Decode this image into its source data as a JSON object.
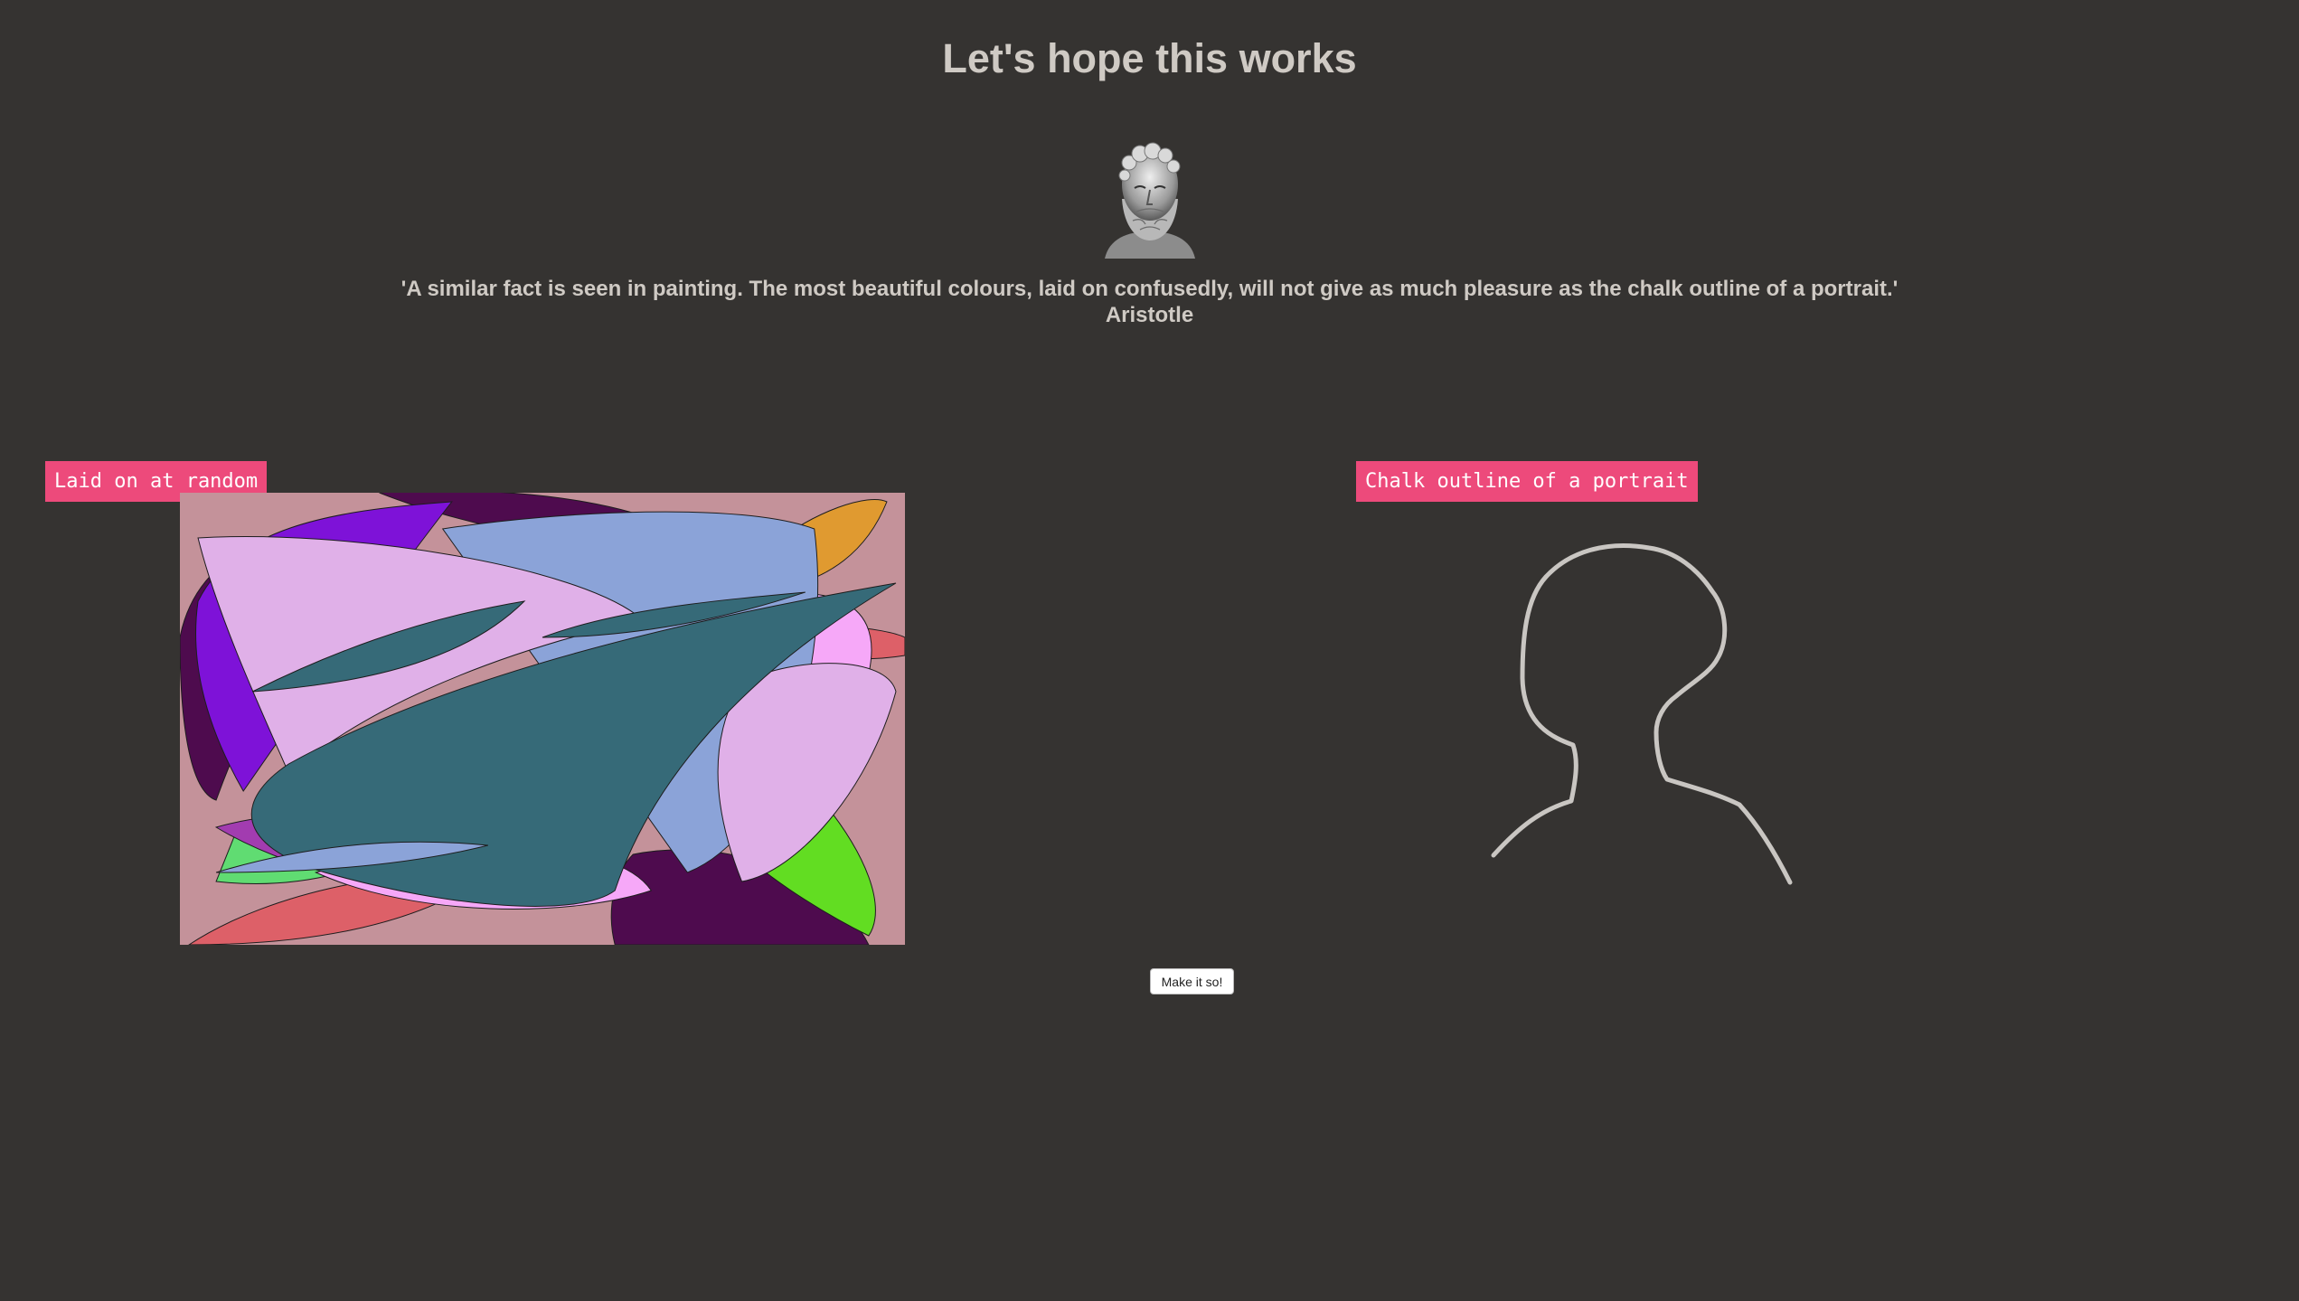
{
  "page": {
    "title": "Let's hope this works"
  },
  "quote": {
    "text": "'A similar fact is seen in painting. The most beautiful colours, laid on confusedly, will not give as much pleasure as the chalk outline of a portrait.'",
    "author": "Aristotle"
  },
  "panels": {
    "left_label": "Laid on at random",
    "right_label": "Chalk outline of a portrait"
  },
  "controls": {
    "make_button_label": "Make it so!"
  },
  "colors": {
    "background": "#353331",
    "text": "#cfcac4",
    "badge": "#ed4a7b",
    "chalk": "#c9c6c2",
    "canvas_bg": "#c4929a"
  },
  "icons": {
    "bust": "aristotle-bust-image"
  }
}
